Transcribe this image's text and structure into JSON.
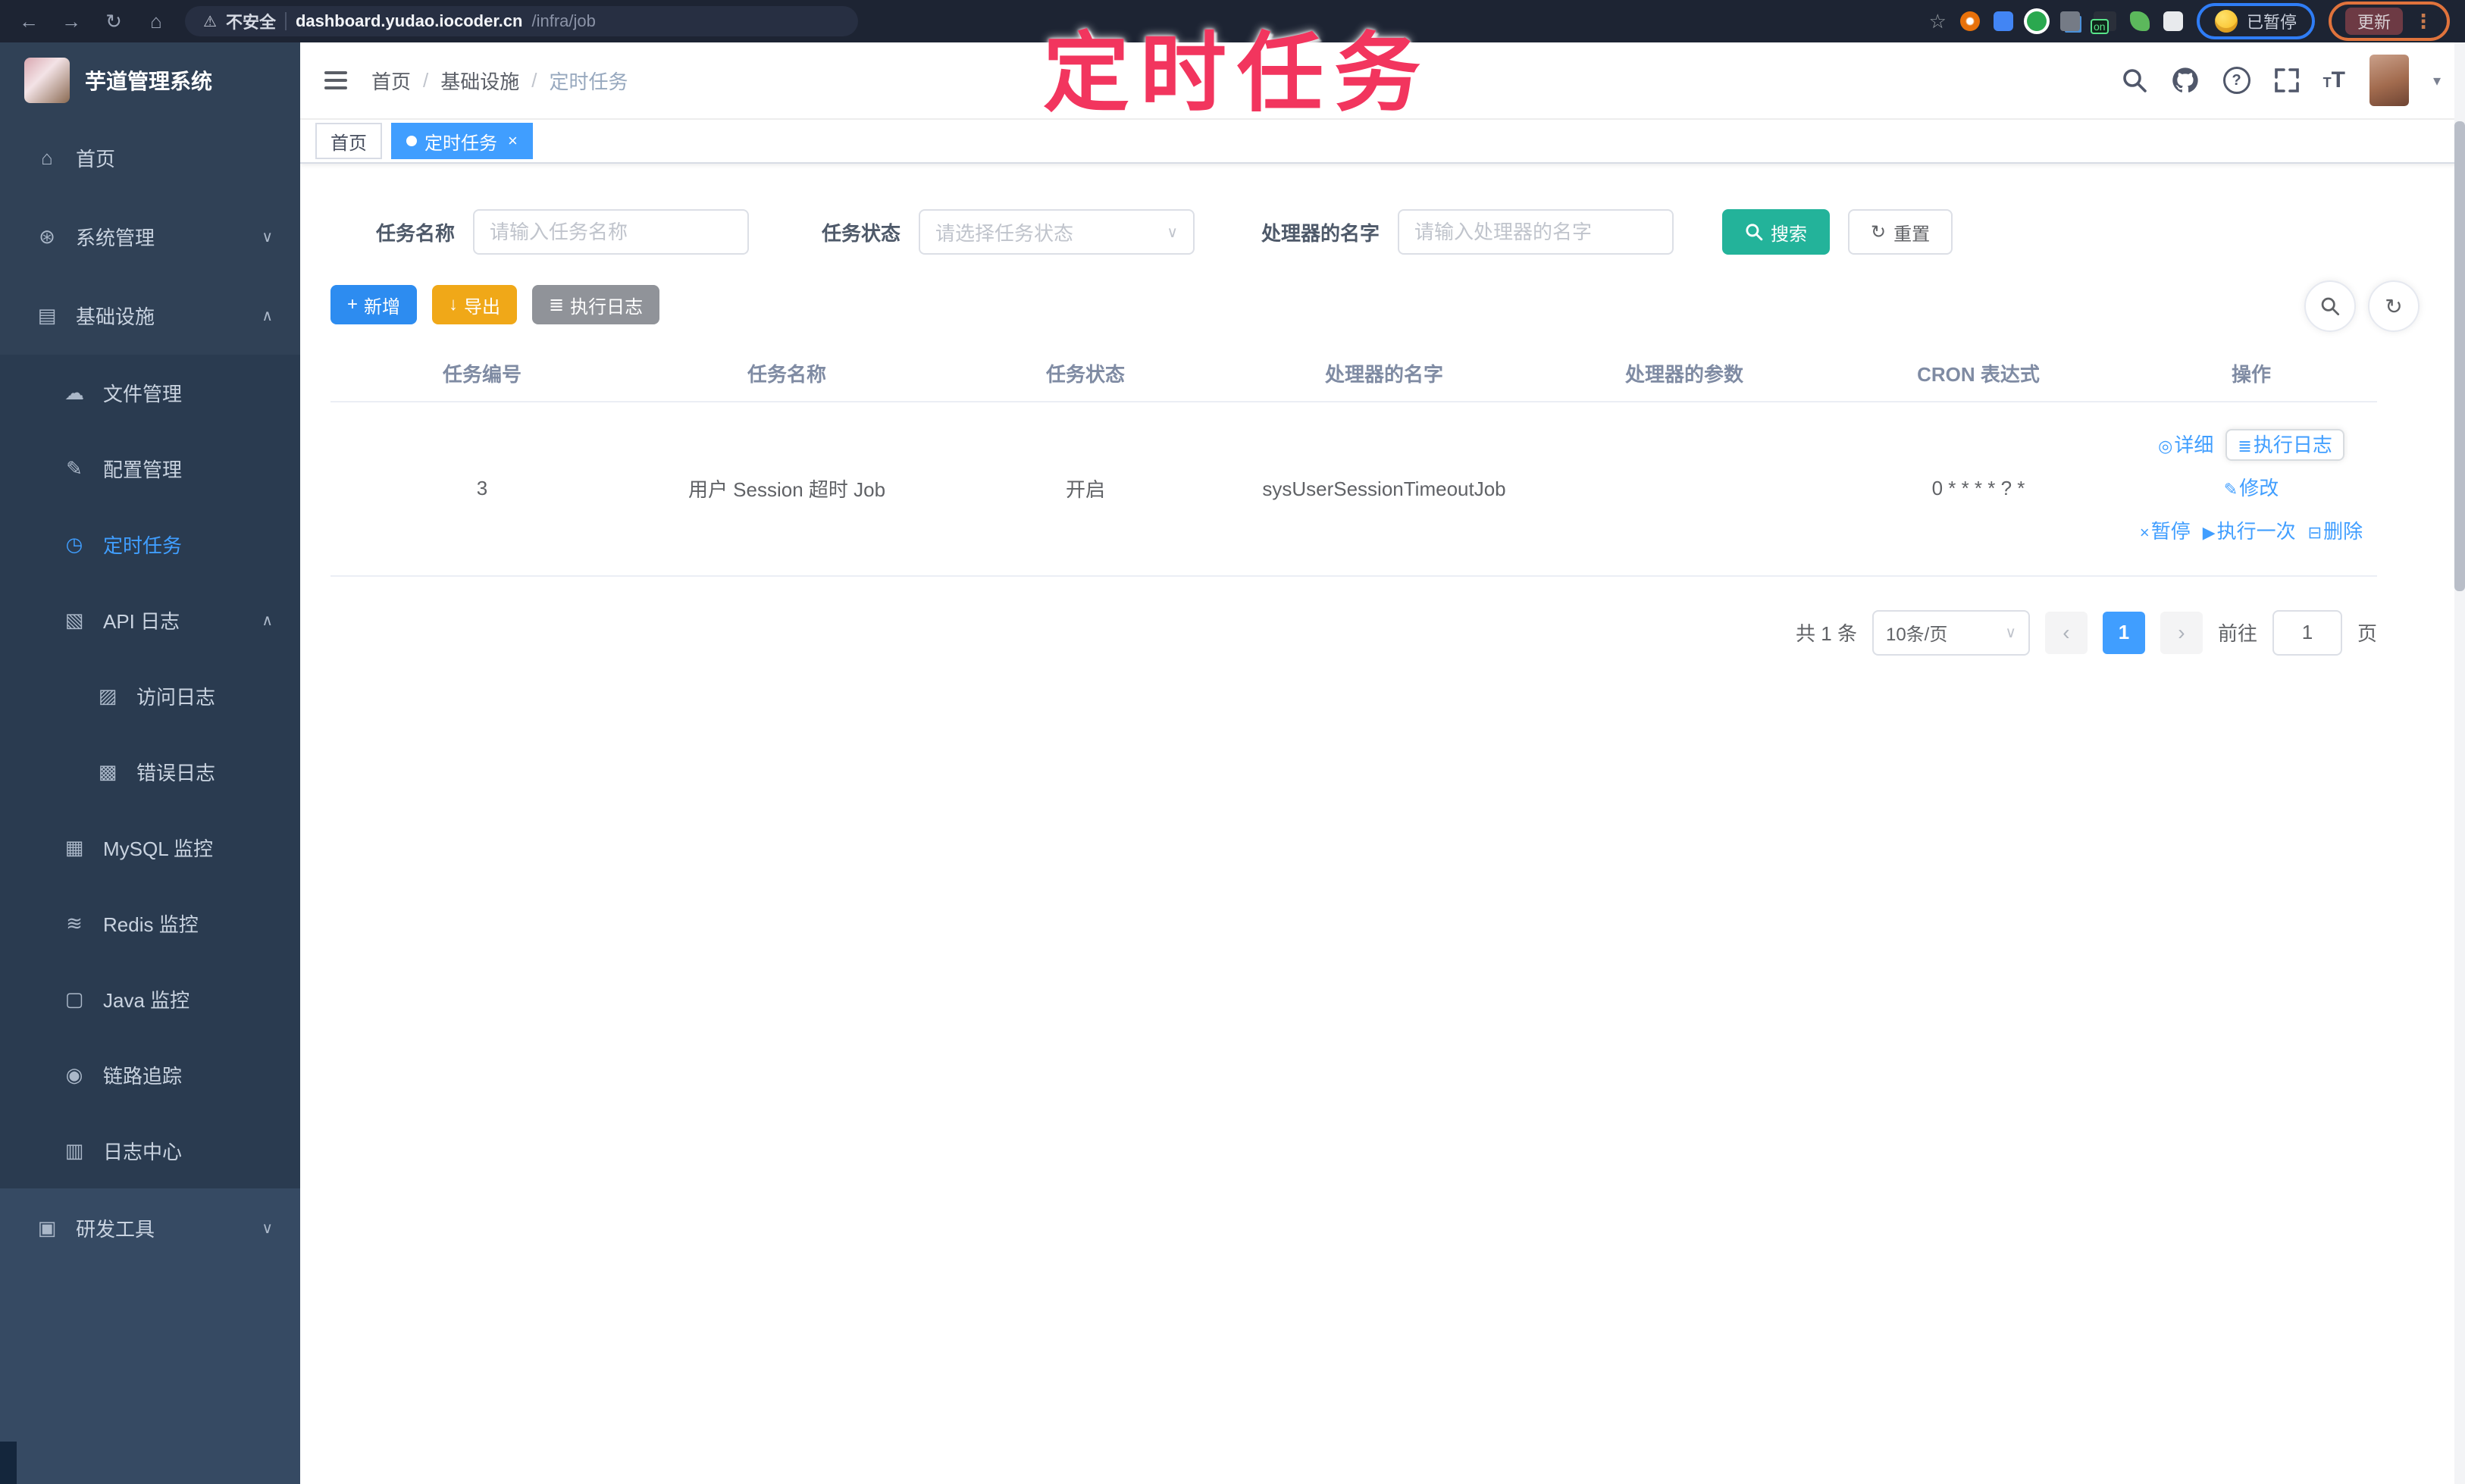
{
  "browser": {
    "security_label": "不安全",
    "url_domain": "dashboard.yudao.iocoder.cn",
    "url_path": "/infra/job",
    "star_icon": "☆",
    "on_badge": "on",
    "paused_label": "已暂停",
    "update_label": "更新"
  },
  "annotation": {
    "text": "定时任务"
  },
  "sidebar": {
    "app_title": "芋道管理系统",
    "items": [
      {
        "label": "首页"
      },
      {
        "label": "系统管理"
      },
      {
        "label": "基础设施"
      },
      {
        "label": "文件管理"
      },
      {
        "label": "配置管理"
      },
      {
        "label": "定时任务"
      },
      {
        "label": "API 日志"
      },
      {
        "label": "访问日志"
      },
      {
        "label": "错误日志"
      },
      {
        "label": "MySQL 监控"
      },
      {
        "label": "Redis 监控"
      },
      {
        "label": "Java 监控"
      },
      {
        "label": "链路追踪"
      },
      {
        "label": "日志中心"
      },
      {
        "label": "研发工具"
      }
    ]
  },
  "navbar": {
    "breadcrumb": [
      "首页",
      "基础设施",
      "定时任务"
    ]
  },
  "tabs": [
    {
      "label": "首页"
    },
    {
      "label": "定时任务"
    }
  ],
  "filter": {
    "name_label": "任务名称",
    "name_placeholder": "请输入任务名称",
    "status_label": "任务状态",
    "status_placeholder": "请选择任务状态",
    "handler_label": "处理器的名字",
    "handler_placeholder": "请输入处理器的名字",
    "search_label": "搜索",
    "reset_label": "重置"
  },
  "toolbar": {
    "add_label": "新增",
    "export_label": "导出",
    "exec_log_label": "执行日志"
  },
  "table": {
    "headers": [
      "任务编号",
      "任务名称",
      "任务状态",
      "处理器的名字",
      "处理器的参数",
      "CRON 表达式",
      "操作"
    ],
    "rows": [
      {
        "id": "3",
        "name": "用户 Session 超时 Job",
        "status": "开启",
        "handler": "sysUserSessionTimeoutJob",
        "param": "",
        "cron": "0 * * * * ? *"
      }
    ],
    "actions": {
      "detail": "详细",
      "exec_log": "执行日志",
      "edit": "修改",
      "pause": "暂停",
      "run_once": "执行一次",
      "delete": "删除"
    }
  },
  "pagination": {
    "total": "共 1 条",
    "page_size": "10条/页",
    "page": "1",
    "goto_label": "前往",
    "goto_value": "1",
    "page_unit": "页"
  },
  "colors": {
    "accent": "#409eff",
    "search_button": "#23b39a",
    "add_button": "#2d8cf0",
    "export_button": "#f0a818",
    "exec_log_button": "#909399",
    "sidebar_bg": "#304156",
    "annotation": "#f2355e"
  }
}
